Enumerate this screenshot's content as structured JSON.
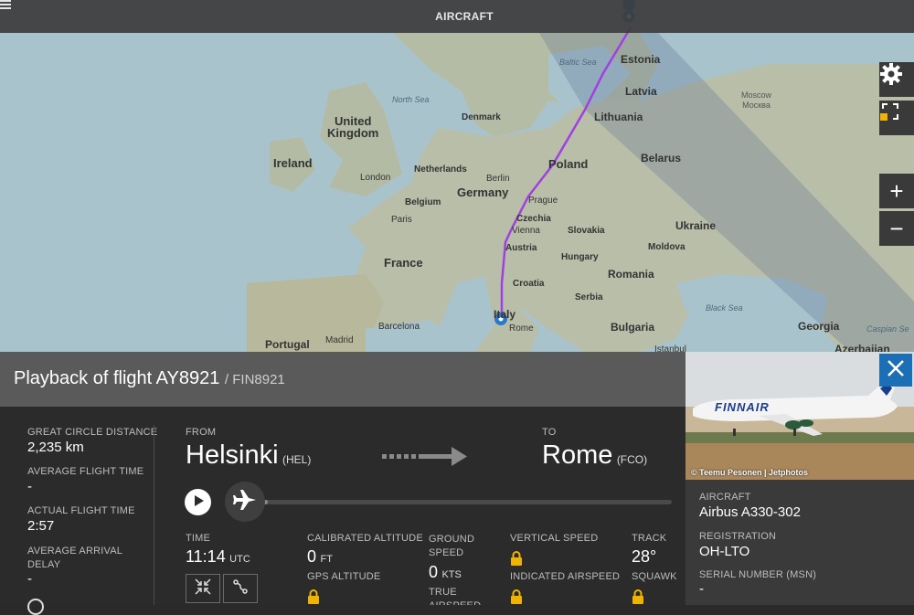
{
  "map": {
    "topbar_label": "AIRCRAFT",
    "labels": {
      "north_sea": "North Sea",
      "baltic_sea": "Baltic Sea",
      "black_sea": "Black Sea",
      "caspian_sea": "Caspian Se",
      "united_kingdom": "United\nKingdom",
      "ireland": "Ireland",
      "london": "London",
      "netherlands": "Netherlands",
      "belgium": "Belgium",
      "paris": "Paris",
      "france": "France",
      "denmark": "Denmark",
      "germany": "Germany",
      "berlin": "Berlin",
      "prague": "Prague",
      "czechia": "Czechia",
      "vienna": "Vienna",
      "austria": "Austria",
      "slovakia": "Slovakia",
      "hungary": "Hungary",
      "croatia": "Croatia",
      "serbia": "Serbia",
      "romania": "Romania",
      "bulgaria": "Bulgaria",
      "italy": "Italy",
      "rome": "Rome",
      "barcelona": "Barcelona",
      "madrid": "Madrid",
      "portugal": "Portugal",
      "poland": "Poland",
      "lithuania": "Lithuania",
      "latvia": "Latvia",
      "estonia": "Estonia",
      "belarus": "Belarus",
      "ukraine": "Ukraine",
      "moldova": "Moldova",
      "moscow": "Москва",
      "moscow_en": "Moscow",
      "georgia": "Georgia",
      "azerbaijan": "Azerbaijan",
      "istanbul": "Istanbul"
    },
    "controls": {
      "zoom_in": "+",
      "zoom_out": "−"
    }
  },
  "flight": {
    "title": "Playback of flight AY8921",
    "callsign": "/ FIN8921",
    "great_circle_label": "GREAT CIRCLE DISTANCE",
    "great_circle_value": "2,235 km",
    "avg_flight_time_label": "AVERAGE FLIGHT TIME",
    "avg_flight_time_value": "-",
    "actual_flight_time_label": "ACTUAL FLIGHT TIME",
    "actual_flight_time_value": "2:57",
    "avg_arrival_delay_label": "AVERAGE ARRIVAL\nDELAY",
    "avg_arrival_delay_value": "-",
    "from_label": "FROM",
    "from_city": "Helsinki",
    "from_code": "(HEL)",
    "to_label": "TO",
    "to_city": "Rome",
    "to_code": "(FCO)",
    "time_label": "TIME",
    "time_value": "11:14",
    "time_unit": "UTC",
    "cal_alt_label": "CALIBRATED ALTITUDE",
    "cal_alt_value": "0",
    "cal_alt_unit": "FT",
    "gps_alt_label": "GPS ALTITUDE",
    "ground_speed_label": "GROUND\nSPEED",
    "ground_speed_value": "0",
    "ground_speed_unit": "KTS",
    "true_airspeed_label": "TRUE\nAIRSPEED",
    "vertical_speed_label": "VERTICAL SPEED",
    "indicated_airspeed_label": "INDICATED AIRSPEED",
    "track_label": "TRACK",
    "track_value": "28°",
    "squawk_label": "SQUAWK",
    "playback_progress": 0.05
  },
  "aircraft": {
    "photo_credit": "© Teemu Pesonen | Jetphotos",
    "livery_text": "FINNAIR",
    "type_label": "AIRCRAFT",
    "type_value": "Airbus A330-302",
    "registration_label": "REGISTRATION",
    "registration_value": "OH-LTO",
    "serial_label": "SERIAL NUMBER (MSN)",
    "serial_value": "-"
  },
  "colors": {
    "route": "#a040e0",
    "lock": "#f0b400",
    "close_button": "#1c6fb5",
    "title_bar": "#5a5a5a",
    "panel": "#2b2b2b"
  }
}
